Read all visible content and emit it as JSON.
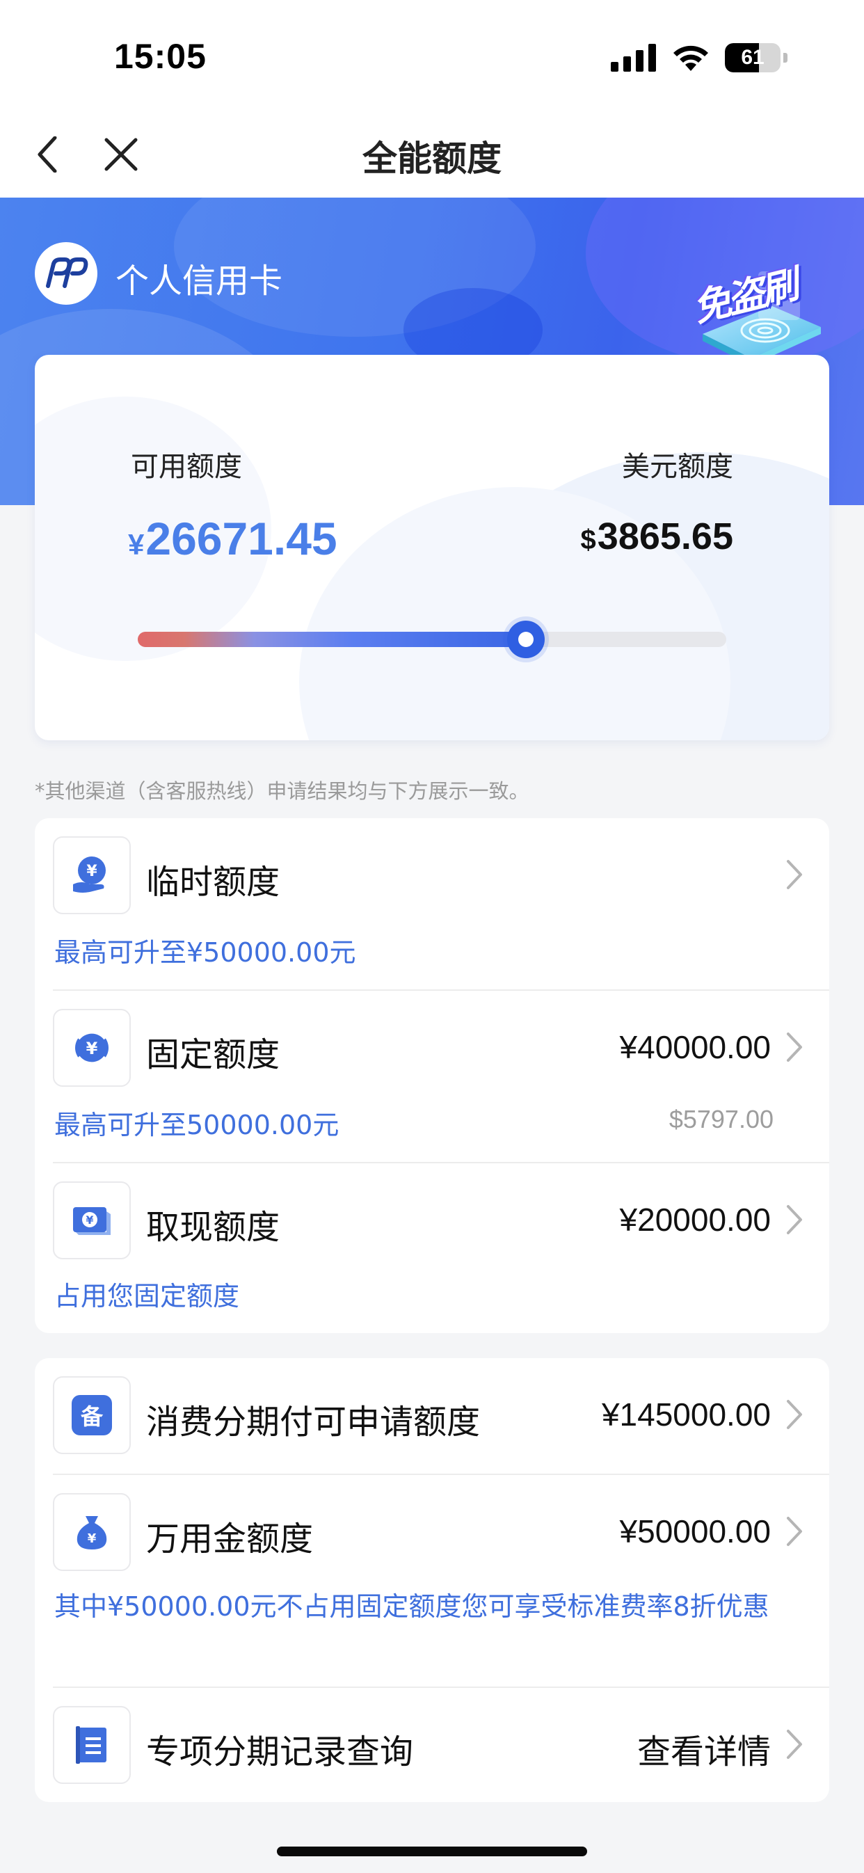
{
  "status_bar": {
    "time": "15:05",
    "battery_level": "61",
    "battery_fraction": 0.61
  },
  "nav": {
    "title": "全能额度",
    "back_icon": "chevron-left-icon",
    "close_icon": "close-icon"
  },
  "header": {
    "brand_title": "个人信用卡",
    "badge_text": "免盗刷"
  },
  "limit_card": {
    "available_label": "可用额度",
    "available_currency": "¥",
    "available_amount": "26671.45",
    "usd_label": "美元额度",
    "usd_currency": "$",
    "usd_amount": "3865.65",
    "usage_fraction": 0.66
  },
  "disclaimer": "*其他渠道（含客服热线）申请结果均与下方展示一致。",
  "section1": {
    "temporary": {
      "title": "临时额度",
      "sub": "最高可升至¥50000.00元",
      "icon": "yuan-hand-icon"
    },
    "fixed": {
      "title": "固定额度",
      "value": "¥40000.00",
      "sub": "最高可升至50000.00元",
      "sub_value": "$5797.00",
      "icon": "yuan-cycle-icon"
    },
    "cash": {
      "title": "取现额度",
      "value": "¥20000.00",
      "sub": "占用您固定额度",
      "icon": "cash-note-icon"
    }
  },
  "section2": {
    "installment": {
      "title": "消费分期付可申请额度",
      "value": "¥145000.00",
      "icon_text": "备",
      "icon": "installment-icon"
    },
    "wanyongjin": {
      "title": "万用金额度",
      "value": "¥50000.00",
      "sub": "其中¥50000.00元不占用固定额度您可享受标准费率8折优惠",
      "icon": "money-bag-icon"
    },
    "special": {
      "title": "专项分期记录查询",
      "value": "查看详情",
      "icon": "document-icon"
    }
  },
  "colors": {
    "accent": "#4a7fe8",
    "link": "#3f6fdd",
    "header_blue": "#3f74ee"
  }
}
